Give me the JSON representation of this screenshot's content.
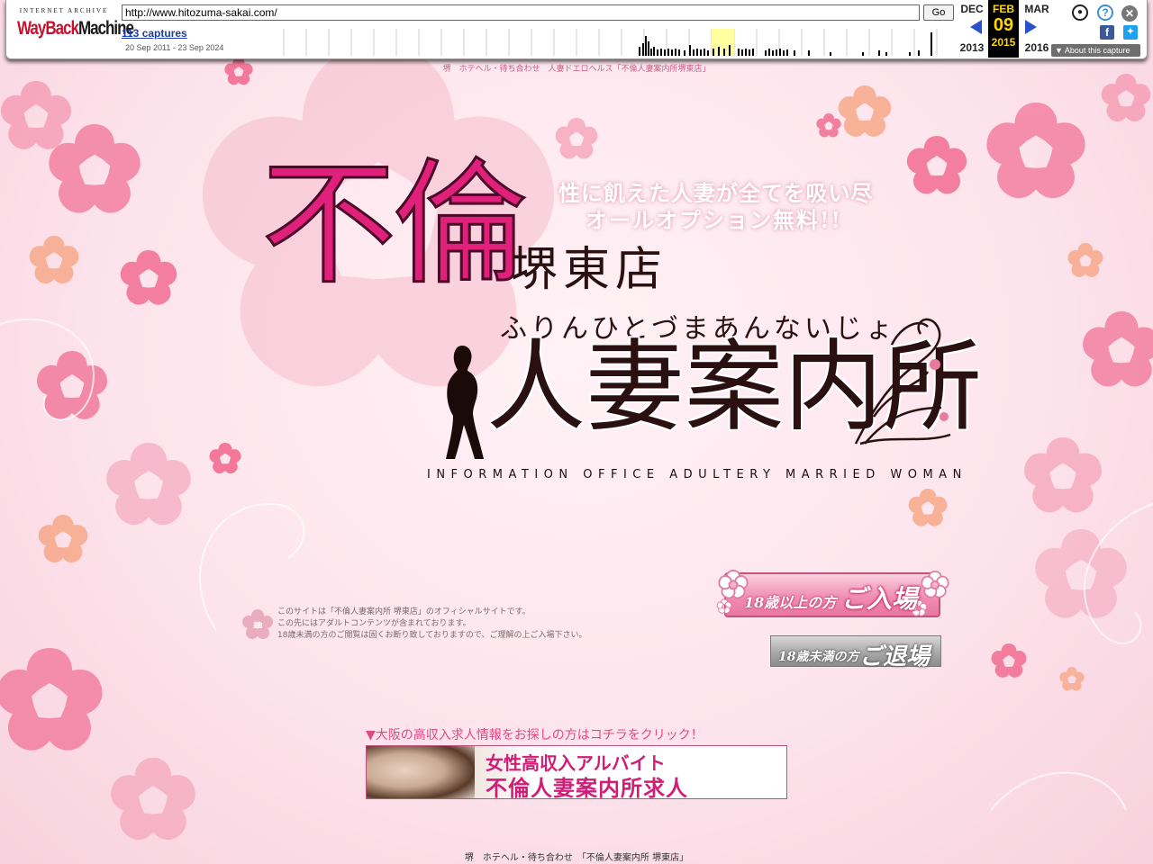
{
  "wayback": {
    "logo_top": "INTERNET ARCHIVE",
    "logo_main": "WayBackMachine",
    "url": "http://www.hitozuma-sakai.com/",
    "go_label": "Go",
    "captures_label": "113 captures",
    "date_range": "20 Sep 2011 - 23 Sep 2024",
    "prev_month": "DEC",
    "prev_year": "2013",
    "current_month": "FEB",
    "current_day": "09",
    "current_year": "2015",
    "next_month": "MAR",
    "next_year": "2016",
    "about_label": "About this capture",
    "icons": [
      "user-icon",
      "help-icon",
      "close-icon",
      "facebook-icon",
      "twitter-icon"
    ]
  },
  "header": {
    "topline": "堺　ホテヘル・待ち合わせ　人妻ドエロヘルス「不倫人妻案内所堺東店」"
  },
  "logo": {
    "catch_line1": "性に飢えた人妻が全てを吸い尽",
    "catch_line2": "オールオプション無料!!",
    "title_main": "不倫",
    "branch": "堺東店",
    "reading": "ふりんひとづまあんないじょ",
    "title_sub": "人妻案内所",
    "title_en": "INFORMATION OFFICE ADULTERY MARRIED WOMAN"
  },
  "notice": {
    "line1": "このサイトは「不倫人妻案内所 堺東店」のオフィシャルサイトです。",
    "line2": "この先にはアダルトコンテンツが含まれております。",
    "line3": "18歳未満の方のご閲覧は固くお断り致しておりますので、ご理解の上ご入場下さい。"
  },
  "buttons": {
    "enter_small": "18歳以上の方",
    "enter_large": "ご入場",
    "exit_small": "18歳未満の方",
    "exit_large": "ご退場"
  },
  "recruit": {
    "link_text": "▼大阪の高収入求人情報をお探しの方はコチラをクリック！",
    "banner_line1": "女性高収入アルバイト",
    "banner_line2": "不倫人妻案内所求人"
  },
  "footer": {
    "text": "堺　ホテヘル・待ち合わせ　「不倫人妻案内所 堺東店」"
  },
  "colors": {
    "accent_pink": "#e0207a",
    "link_pink": "#e04a83",
    "wayback_yellow": "#ffd700",
    "wayback_blue": "#2a52c8"
  }
}
